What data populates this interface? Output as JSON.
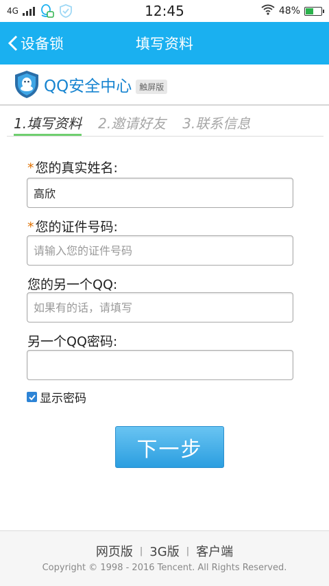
{
  "status_bar": {
    "network": "4G",
    "time": "12:45",
    "battery_percent": "48%",
    "battery_level": 0.48
  },
  "header": {
    "back_label": "设备锁",
    "title": "填写资料"
  },
  "brand": {
    "name": "QQ安全中心",
    "badge": "触屏版"
  },
  "steps": [
    {
      "label": "1.填写资料",
      "active": true
    },
    {
      "label": "2.邀请好友",
      "active": false
    },
    {
      "label": "3.联系信息",
      "active": false
    }
  ],
  "form": {
    "required_mark": "*",
    "name_label": "您的真实姓名:",
    "name_value": "高欣",
    "id_label": "您的证件号码:",
    "id_placeholder": "请输入您的证件号码",
    "other_qq_label": "您的另一个QQ:",
    "other_qq_placeholder": "如果有的话，请填写",
    "other_pass_label": "另一个QQ密码:",
    "other_pass_value": "",
    "show_password_label": "显示密码",
    "show_password_checked": true,
    "next_label": "下一步"
  },
  "footer": {
    "links": [
      "网页版",
      "3G版",
      "客户端"
    ],
    "separator": "|",
    "copyright": "Copyright © 1998 - 2016 Tencent. All Rights Reserved."
  },
  "colors": {
    "header_bg": "#1ab0f0",
    "brand_blue": "#1784d0",
    "active_step_underline": "#6fcf6f",
    "required": "#e07000"
  }
}
